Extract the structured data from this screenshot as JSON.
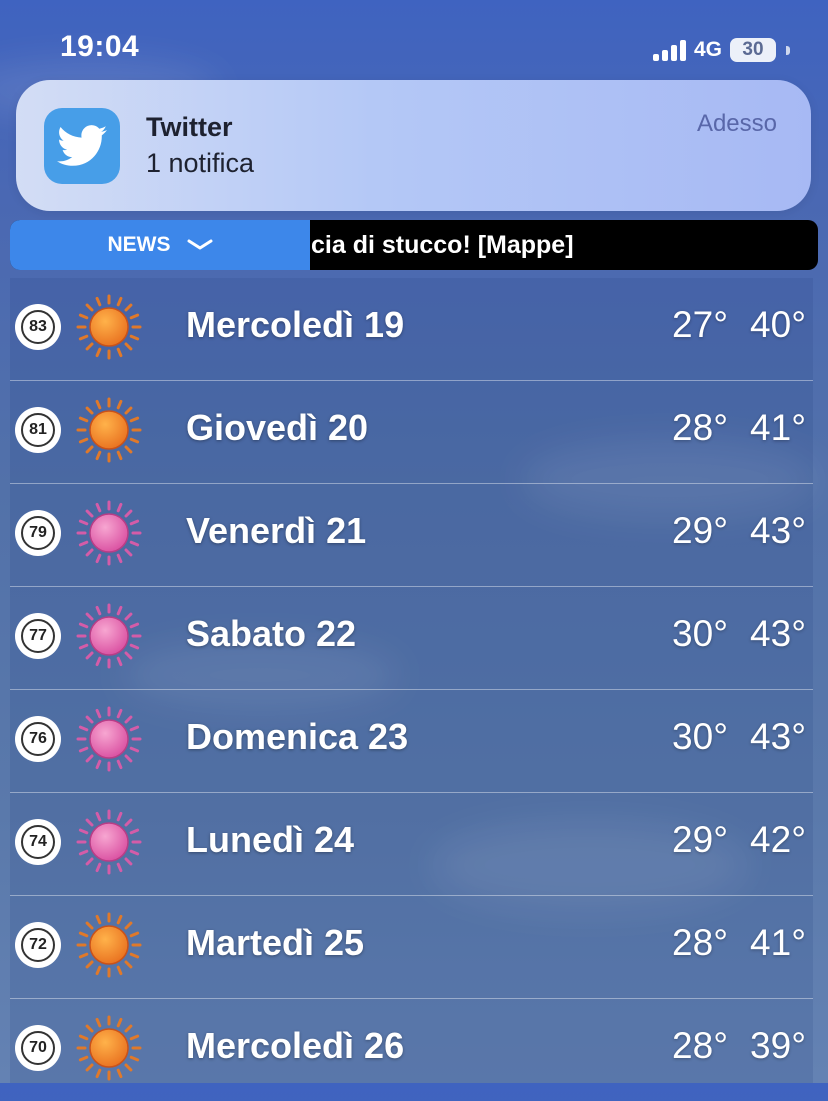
{
  "status_bar": {
    "time": "19:04",
    "network": "4G",
    "battery": "30"
  },
  "notification": {
    "app_name": "Twitter",
    "body": "1 notifica",
    "time": "Adesso"
  },
  "ticker": {
    "button_label": "NEWS",
    "headline": "cia di stucco! [Mappe]"
  },
  "forecast": [
    {
      "uv": "83",
      "icon": "sun-orange",
      "day": "Mercoledì 19",
      "low": "27°",
      "high": "40°"
    },
    {
      "uv": "81",
      "icon": "sun-orange",
      "day": "Giovedì 20",
      "low": "28°",
      "high": "41°"
    },
    {
      "uv": "79",
      "icon": "sun-pink",
      "day": "Venerdì 21",
      "low": "29°",
      "high": "43°"
    },
    {
      "uv": "77",
      "icon": "sun-pink",
      "day": "Sabato 22",
      "low": "30°",
      "high": "43°"
    },
    {
      "uv": "76",
      "icon": "sun-pink",
      "day": "Domenica 23",
      "low": "30°",
      "high": "43°"
    },
    {
      "uv": "74",
      "icon": "sun-pink",
      "day": "Lunedì 24",
      "low": "29°",
      "high": "42°"
    },
    {
      "uv": "72",
      "icon": "sun-orange",
      "day": "Martedì 25",
      "low": "28°",
      "high": "41°"
    },
    {
      "uv": "70",
      "icon": "sun-orange",
      "day": "Mercoledì 26",
      "low": "28°",
      "high": "39°"
    }
  ],
  "colors": {
    "sun_orange": "#e8701f",
    "sun_pink": "#d94ea0",
    "twitter_blue": "#479ee8",
    "news_blue": "#3d87ea"
  }
}
